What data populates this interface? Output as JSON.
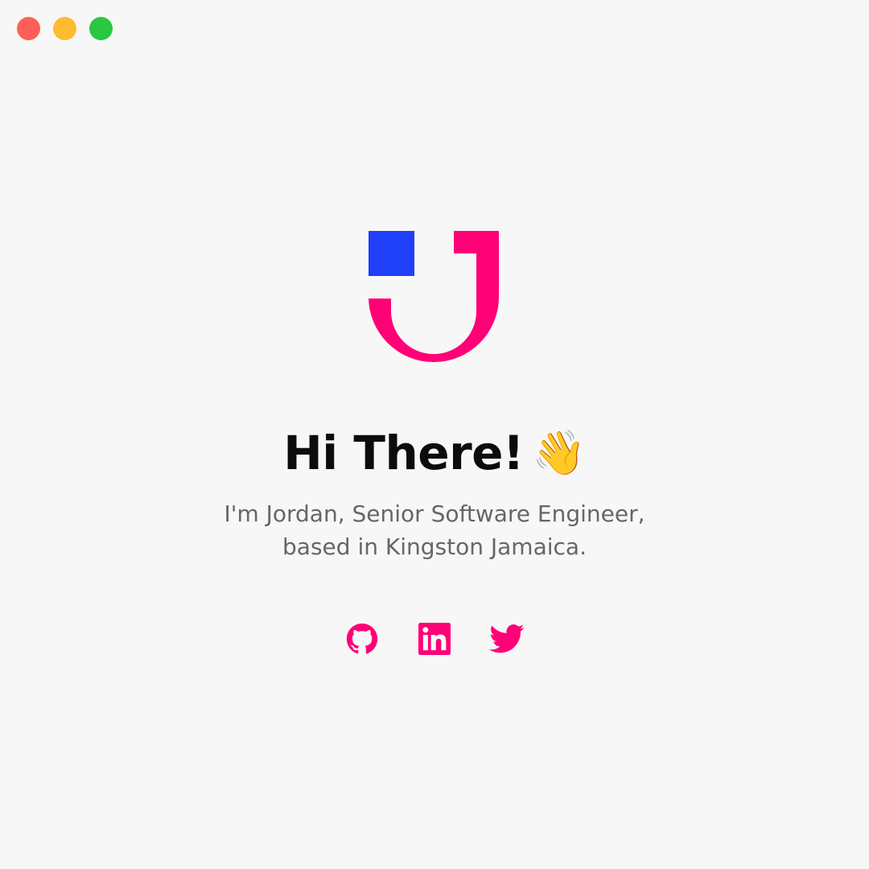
{
  "window": {
    "controls": [
      {
        "name": "close",
        "color": "#ff5f57"
      },
      {
        "name": "minimize",
        "color": "#febc2e"
      },
      {
        "name": "maximize",
        "color": "#28c840"
      }
    ]
  },
  "brand": {
    "logo_icon": "jordan-logo-icon",
    "primary_color": "#ff0077",
    "secondary_color": "#1f3ff8"
  },
  "hero": {
    "greeting": "Hi There!",
    "greeting_emoji": "👋",
    "bio_line_1": "I'm Jordan, Senior Software Engineer,",
    "bio_line_2": "based in Kingston Jamaica."
  },
  "socials": [
    {
      "label": "GitHub",
      "icon": "github-icon"
    },
    {
      "label": "LinkedIn",
      "icon": "linkedin-icon"
    },
    {
      "label": "Twitter",
      "icon": "twitter-icon"
    }
  ]
}
